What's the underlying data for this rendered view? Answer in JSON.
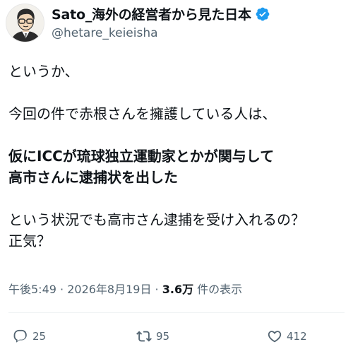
{
  "author": {
    "display_name": "Sato_海外の経営者から見た日本",
    "handle": "@hetare_keieisha"
  },
  "body": {
    "para1": "というか、",
    "para2": "今回の件で赤根さんを擁護している人は、",
    "para3_line1": "仮にICCが琉球独立運動家とかが関与して",
    "para3_line2": "高市さんに逮捕状を出した",
    "para4_line1": "という状況でも高市さん逮捕を受け入れるの？",
    "para4_line2": "正気？"
  },
  "meta": {
    "time": "午後5:49",
    "separator1": " · ",
    "date": "2026年8月19日",
    "separator2": " · ",
    "views_count": "3.6万",
    "views_label": " 件の表示"
  },
  "actions": {
    "reply_count": "25",
    "retweet_count": "95",
    "like_count": "412"
  },
  "colors": {
    "verified": "#1d9bf0",
    "muted": "#536471",
    "text": "#0f1419"
  },
  "icons": {
    "avatar": "avatar-illustration",
    "verified": "verified-badge-icon",
    "reply": "reply-icon",
    "retweet": "retweet-icon",
    "like": "heart-icon"
  }
}
